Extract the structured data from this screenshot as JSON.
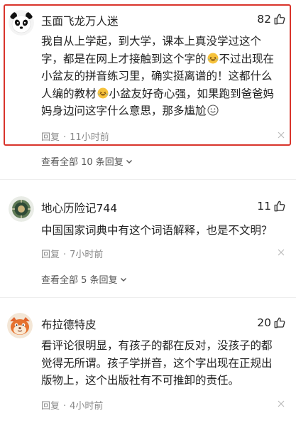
{
  "comments": [
    {
      "username": "玉面飞龙万人迷",
      "likes": "82",
      "text_parts": [
        "我自从上学起，到大学，课本上真没学过这个字，都是在网上才接触到这个字的",
        "不过出现在小盆友的拼音练习里，确实挺离谱的！这都什么人编的教材",
        "小盆友好奇心强，如果跑到爸爸妈妈身边问这字什么意思，那多尴尬"
      ],
      "reply_label": "回复",
      "time": "11小时前",
      "expand_label": "查看全部 10 条回复"
    },
    {
      "username": "地心历险记744",
      "likes": "11",
      "text": "中国国家词典中有这个词语解释，也是不文明？",
      "reply_label": "回复",
      "time": "7小时前",
      "expand_label": "查看全部 5 条回复"
    },
    {
      "username": "布拉德特皮",
      "likes": "20",
      "text": "看评论很明显，有孩子的都在反对，没孩子的都觉得无所谓。孩子学拼音，这个字出现在正规出版物上，这个出版社有不可推卸的责任。",
      "reply_label": "回复",
      "time": "4小时前"
    }
  ],
  "colors": {
    "highlight_border": "#d9342b",
    "meta": "#8a8a8a"
  },
  "icons": [
    "thumbs-up-icon",
    "close-icon",
    "chevron-down-icon",
    "laughing-crying-emoji",
    "smile-emoji"
  ]
}
